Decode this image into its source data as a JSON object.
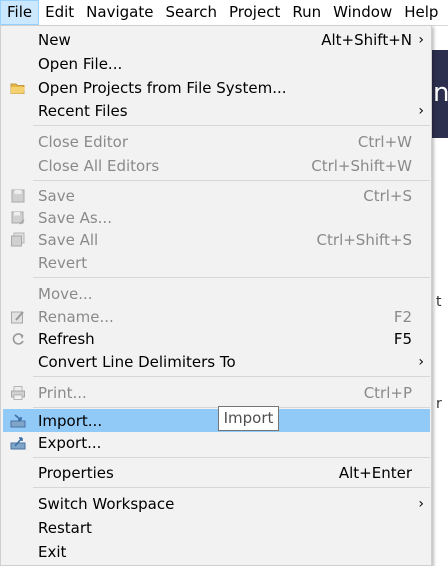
{
  "menubar": {
    "items": [
      "File",
      "Edit",
      "Navigate",
      "Search",
      "Project",
      "Run",
      "Window",
      "Help"
    ]
  },
  "background": {
    "dark_fragment": "n",
    "text_fragments": [
      "t",
      "r"
    ]
  },
  "file_menu": {
    "new": {
      "label": "New",
      "accel": "Alt+Shift+N",
      "submenu": true
    },
    "open_file": {
      "label": "Open File..."
    },
    "open_projects": {
      "label": "Open Projects from File System..."
    },
    "recent_files": {
      "label": "Recent Files",
      "submenu": true
    },
    "close_editor": {
      "label": "Close Editor",
      "accel": "Ctrl+W"
    },
    "close_all_editors": {
      "label": "Close All Editors",
      "accel": "Ctrl+Shift+W"
    },
    "save": {
      "label": "Save",
      "accel": "Ctrl+S"
    },
    "save_as": {
      "label": "Save As..."
    },
    "save_all": {
      "label": "Save All",
      "accel": "Ctrl+Shift+S"
    },
    "revert": {
      "label": "Revert"
    },
    "move": {
      "label": "Move..."
    },
    "rename": {
      "label": "Rename...",
      "accel": "F2"
    },
    "refresh": {
      "label": "Refresh",
      "accel": "F5"
    },
    "convert": {
      "label": "Convert Line Delimiters To",
      "submenu": true
    },
    "print": {
      "label": "Print...",
      "accel": "Ctrl+P"
    },
    "import": {
      "label": "Import..."
    },
    "export": {
      "label": "Export..."
    },
    "properties": {
      "label": "Properties",
      "accel": "Alt+Enter"
    },
    "switch_workspace": {
      "label": "Switch Workspace",
      "submenu": true
    },
    "restart": {
      "label": "Restart"
    },
    "exit": {
      "label": "Exit"
    }
  },
  "tooltip": {
    "text": "Import"
  },
  "colors": {
    "hover": "#91c9f7",
    "menu_bg": "#f2f2f2",
    "disabled_text": "#8a8a8a",
    "active_menubar": "#cce8ff"
  }
}
